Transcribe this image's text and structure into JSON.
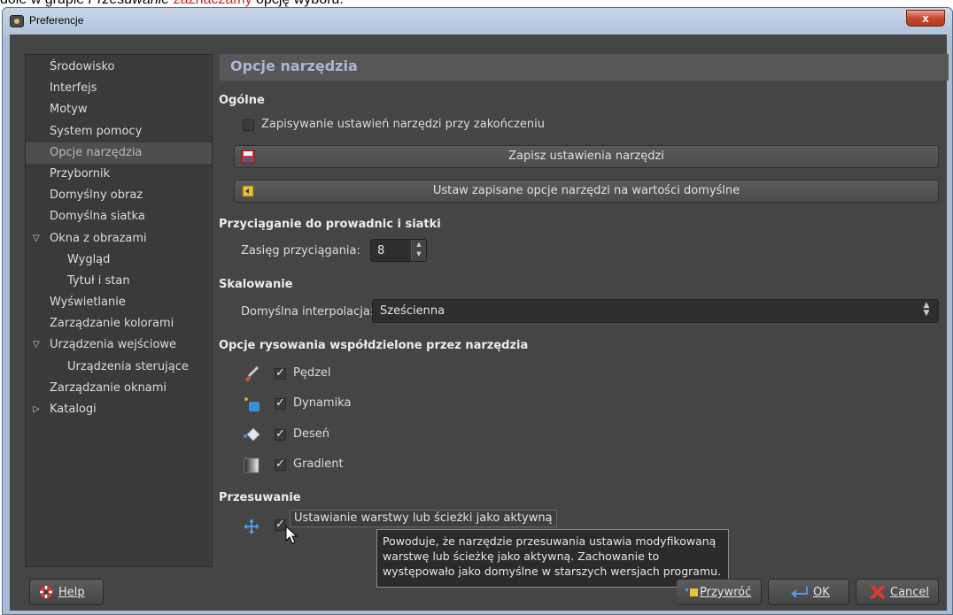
{
  "caption": {
    "part1": "dole w grupie ",
    "part2": "Przesuwanie",
    "part3": " zaznaczamy",
    "part4": " opcję wyboru."
  },
  "window": {
    "title": "Preferencje",
    "close_glyph": "x"
  },
  "tree": {
    "items": [
      {
        "label": "Środowisko"
      },
      {
        "label": "Interfejs"
      },
      {
        "label": "Motyw"
      },
      {
        "label": "System pomocy"
      },
      {
        "label": "Opcje narzędzia"
      },
      {
        "label": "Przybornik"
      },
      {
        "label": "Domyślny obraz"
      },
      {
        "label": "Domyślna siatka"
      },
      {
        "label": "Okna z obrazami"
      },
      {
        "label": "Wygląd"
      },
      {
        "label": "Tytuł i stan"
      },
      {
        "label": "Wyświetlanie"
      },
      {
        "label": "Zarządzanie kolorami"
      },
      {
        "label": "Urządzenia wejściowe"
      },
      {
        "label": "Urządzenia sterujące"
      },
      {
        "label": "Zarządzanie oknami"
      },
      {
        "label": "Katalogi"
      }
    ],
    "selected": "Opcje narzędzia"
  },
  "page": {
    "title": "Opcje narzędzia",
    "general": {
      "heading": "Ogólne",
      "save_on_exit": "Zapisywanie ustawień narzędzi przy zakończeniu",
      "save_on_exit_checked": false,
      "save_button": "Zapisz ustawienia narzędzi",
      "reset_button": "Ustaw zapisane opcje narzędzi na wartości domyślne"
    },
    "snapping": {
      "heading": "Przyciąganie do prowadnic i siatki",
      "range_label": "Zasięg przyciągania:",
      "range_value": "8"
    },
    "scaling": {
      "heading": "Skalowanie",
      "interp_label": "Domyślna interpolacja:",
      "interp_value": "Sześcienna"
    },
    "paint": {
      "heading": "Opcje rysowania współdzielone przez narzędzia",
      "brush": "Pędzel",
      "dynamics": "Dynamika",
      "pattern": "Deseń",
      "gradient": "Gradient"
    },
    "move": {
      "heading": "Przesuwanie",
      "option": "Ustawianie warstwy lub ścieżki jako aktywną"
    },
    "tooltip": {
      "line1": "Powoduje, że narzędzie przesuwania ustawia modyfikowaną",
      "line2": "warstwę lub ścieżkę jako aktywną. Zachowanie to",
      "line3": "występowało jako domyślne w starszych wersjach programu."
    }
  },
  "buttons": {
    "help": "Help",
    "reset": "Przywróć",
    "ok": "OK",
    "cancel": "Cancel"
  },
  "colors": {
    "caption_red": "#d2232a",
    "title_blue": "#aab6d6",
    "cancel_red": "#d93a2b"
  }
}
